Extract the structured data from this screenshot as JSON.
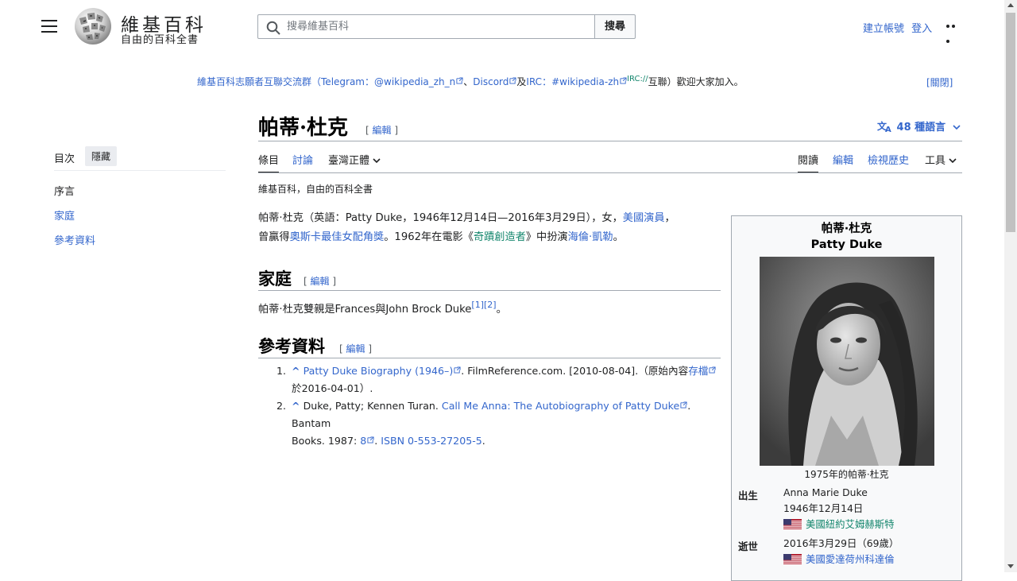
{
  "header": {
    "wordmark": "維基百科",
    "tagline": "自由的百科全書",
    "search_placeholder": "搜尋維基百科",
    "search_button": "搜尋",
    "create_account": "建立帳號",
    "login": "登入"
  },
  "notice": {
    "part1": "維基百科志願者互聯交流群（",
    "telegram_label": "Telegram：",
    "telegram_link": "@wikipedia_zh_n",
    "sep1": "、",
    "discord": "Discord",
    "and": "及",
    "irc_label": "IRC：",
    "irc_link": "#wikipedia-zh",
    "irc_sup": "IRC://",
    "part2": "互聯）歡迎大家加入。",
    "close": "[關閉]"
  },
  "toc": {
    "title": "目次",
    "hide": "隱藏",
    "items": [
      "序言",
      "家庭",
      "參考資料"
    ]
  },
  "article": {
    "title": "帕蒂·杜克",
    "edit": "編輯",
    "languages": "48 種語言",
    "tabs": {
      "article": "條目",
      "talk": "討論",
      "variant": "臺灣正體",
      "read": "閱讀",
      "edit": "編輯",
      "history": "檢視歷史",
      "tools": "工具"
    },
    "tagline": "維基百科，自由的百科全書",
    "lead": {
      "name": "帕蒂·杜克",
      "t1": "（英語：Patty Duke，1946年12月14日—2016年3月29日），女，",
      "link1": "美國演員",
      "t2": "，",
      "t3": "曾贏得",
      "link2": "奧斯卡最佳女配角獎",
      "t4": "。1962年在電影《",
      "link3": "奇蹟創造者",
      "t5": "》中扮演",
      "link4": "海倫·凱勒",
      "t6": "。"
    },
    "sections": {
      "family": {
        "heading": "家庭",
        "text": "帕蒂·杜克雙親是Frances與John Brock Duke",
        "ref1": "[1]",
        "ref2": "[2]",
        "end": "。"
      },
      "references": {
        "heading": "參考資料",
        "items": [
          {
            "num": "1.",
            "caret": "^",
            "link": "Patty Duke Biography (1946–)",
            "text1": ". FilmReference.com. [2010-08-04].（原始內容",
            "archive": "存檔",
            "text2": "於2016-04-01）."
          },
          {
            "num": "2.",
            "caret": "^",
            "text1": "Duke, Patty; Kennen Turan. ",
            "link": "Call Me Anna: The Autobiography of Patty Duke",
            "text2": ". Bantam",
            "text3": "Books. 1987: ",
            "page": "8",
            "isbn": "ISBN 0-553-27205-5",
            "end": "."
          }
        ]
      }
    }
  },
  "infobox": {
    "name_zh": "帕蒂·杜克",
    "name_en": "Patty Duke",
    "caption": "1975年的帕蒂·杜克",
    "born_label": "出生",
    "born_name": "Anna Marie Duke",
    "born_date": "1946年12月14日",
    "born_place": "美國紐約艾姆赫斯特",
    "died_label": "逝世",
    "died_date": "2016年3月29日（69歲）",
    "died_place": "美國愛達荷州科達倫"
  },
  "colors": {
    "link": "#3366cc",
    "visited": "#6a3fbf",
    "green_link": "#14866d",
    "border": "#a2a9b1"
  }
}
